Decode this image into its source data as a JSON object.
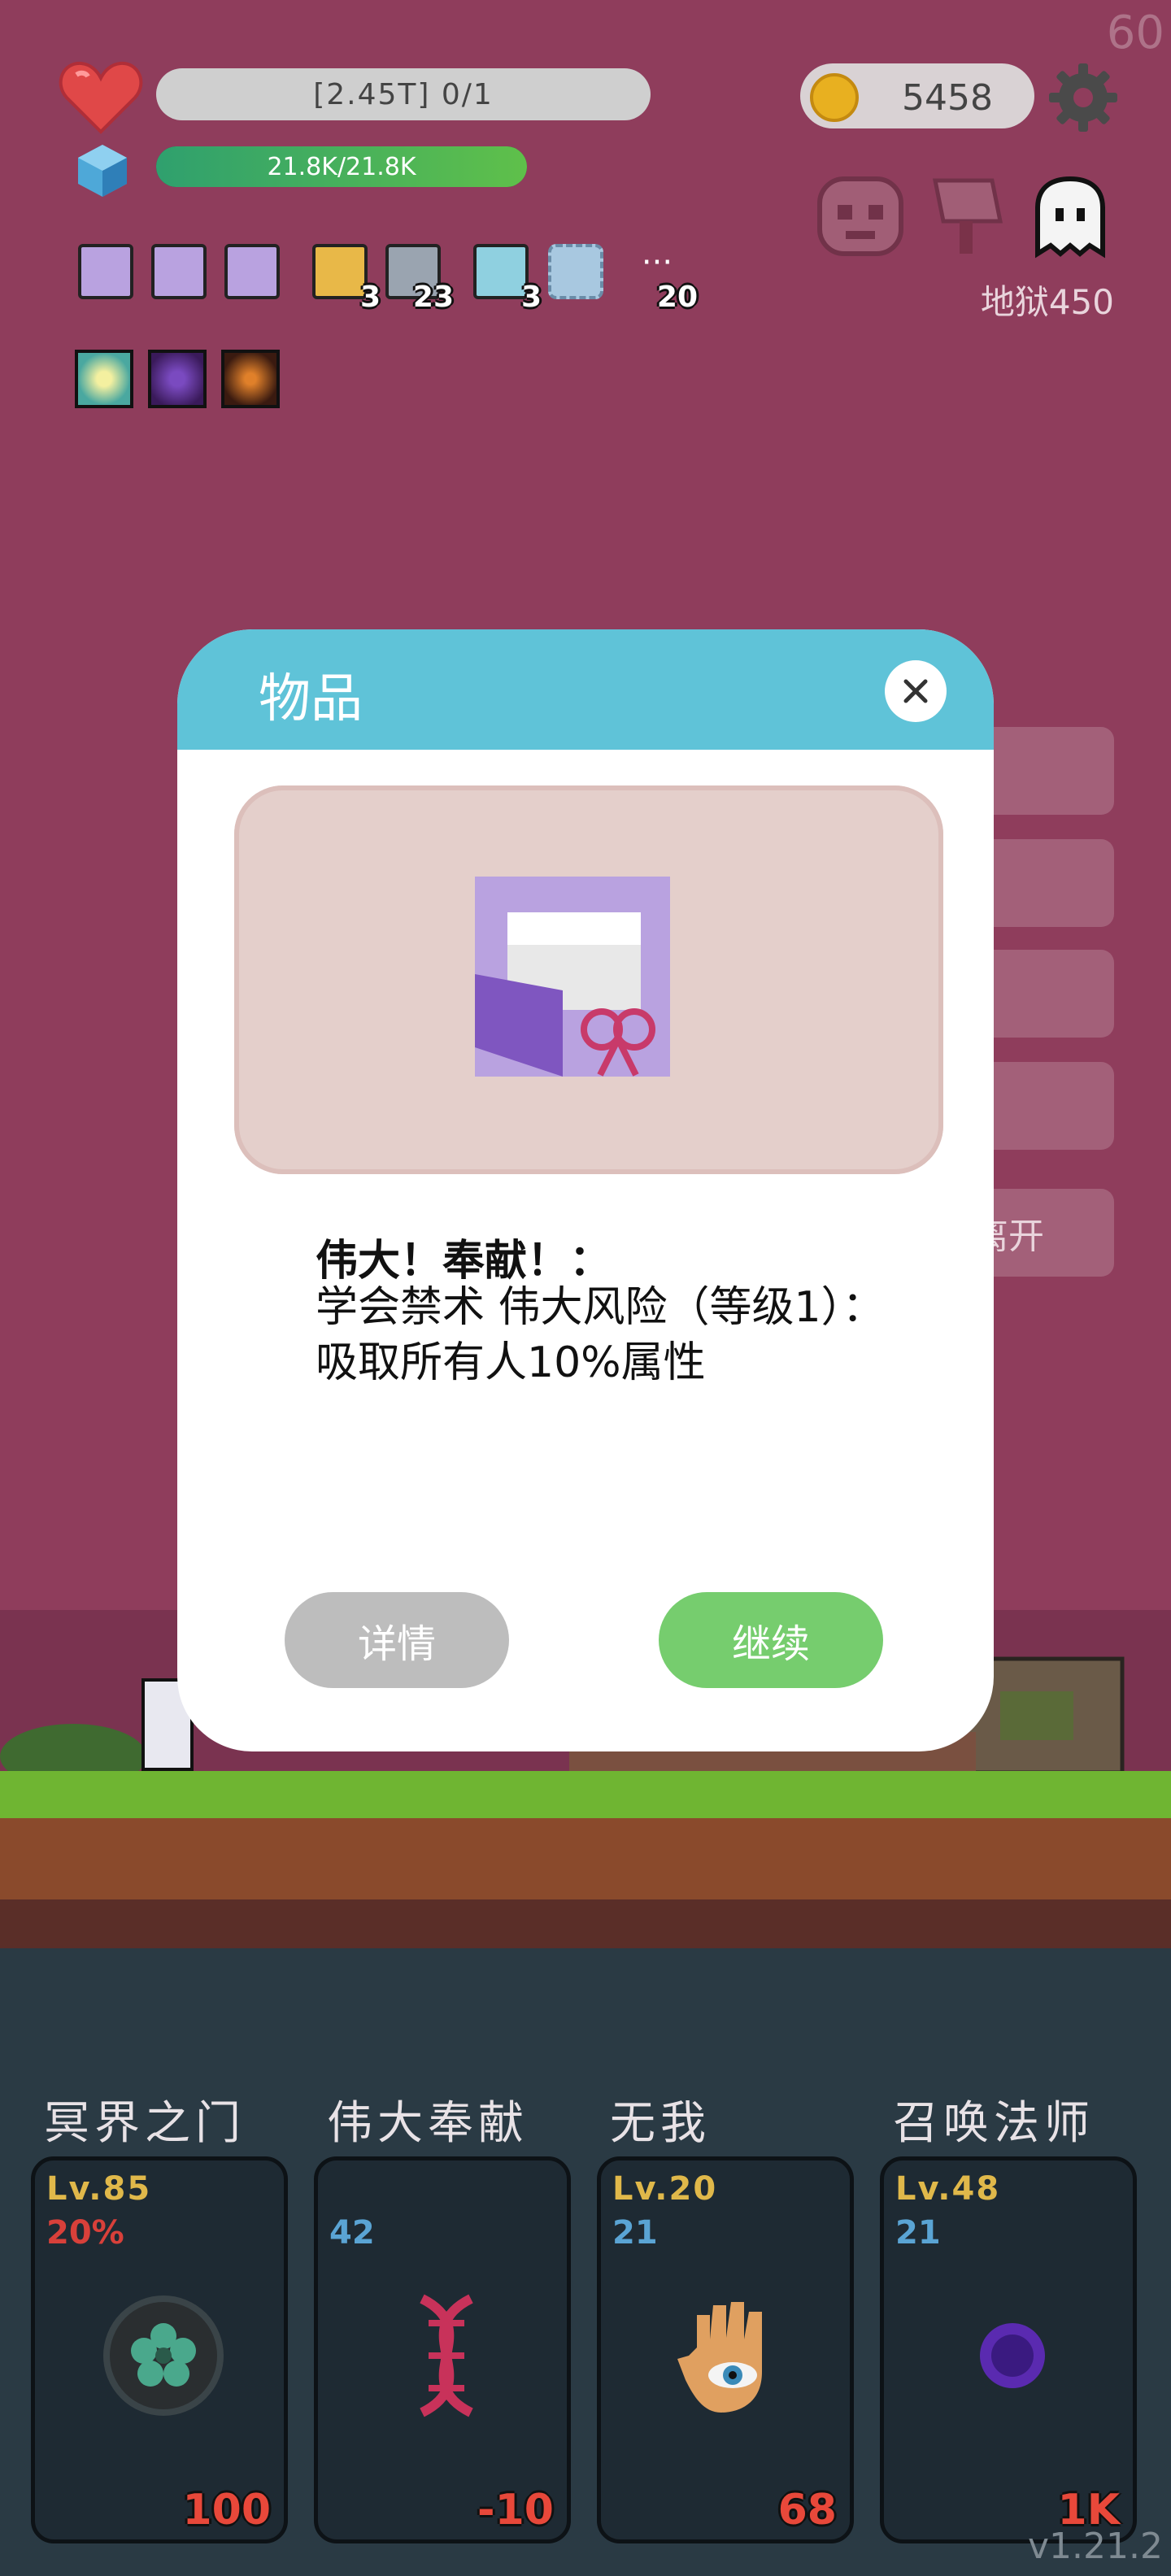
{
  "hud": {
    "fps": "60",
    "hp_text": "[2.45T] 0/1",
    "mp_text": "21.8K/21.8K",
    "mp_fill": 1.0,
    "gold": "5458",
    "area_label": "地狱450"
  },
  "items": [
    {
      "icon": "gift-scroll-icon",
      "count": ""
    },
    {
      "icon": "gift-scroll-icon",
      "count": ""
    },
    {
      "icon": "gift-scroll-icon",
      "count": ""
    },
    {
      "icon": "beer-mug-icon",
      "count": "3"
    },
    {
      "icon": "sword-icon",
      "count": "23"
    },
    {
      "icon": "syringe-icon",
      "count": "3"
    },
    {
      "icon": "empty-slot-icon",
      "count": ""
    },
    {
      "icon": "more-icon",
      "count": "20"
    }
  ],
  "scene": {
    "side_button_label": "离开"
  },
  "dialog": {
    "title": "物品",
    "item_title": "伟大！奉献！：",
    "item_desc": "学会禁术 伟大风险（等级1）：吸取所有人10%属性",
    "detail_button": "详情",
    "continue_button": "继续"
  },
  "skills": [
    {
      "name": "冥界之门",
      "level": "Lv.85",
      "sub": "20%",
      "sub_color": "#d8403a",
      "value": "100",
      "icon": "flower-portal-icon"
    },
    {
      "name": "伟大奉献",
      "level": "",
      "sub": "42",
      "sub_color": "#5aa4d4",
      "value": "-10",
      "icon": "dna-icon"
    },
    {
      "name": "无我",
      "level": "Lv.20",
      "sub": "21",
      "sub_color": "#5aa4d4",
      "value": "68",
      "icon": "hand-eye-icon"
    },
    {
      "name": "召唤法师",
      "level": "Lv.48",
      "sub": "21",
      "sub_color": "#5aa4d4",
      "value": "1K",
      "icon": "dark-orb-icon"
    }
  ],
  "version": "v1.21.2"
}
